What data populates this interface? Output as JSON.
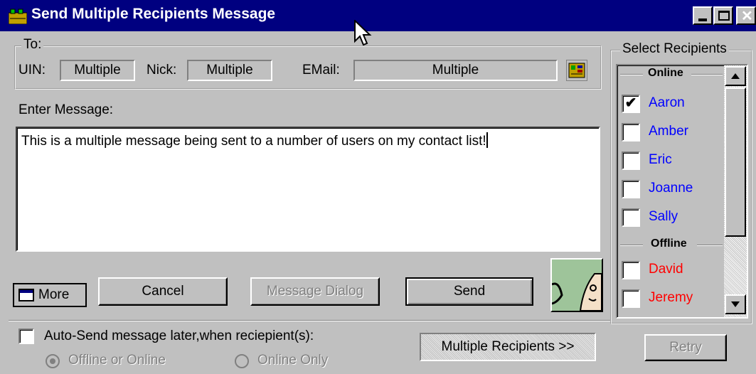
{
  "window": {
    "title": "Send Multiple Recipients Message"
  },
  "to": {
    "legend": "To:",
    "uin_label": "UIN:",
    "uin_value": "Multiple",
    "nick_label": "Nick:",
    "nick_value": "Multiple",
    "email_label": "EMail:",
    "email_value": "Multiple"
  },
  "message": {
    "label": "Enter Message:",
    "text": "This is a multiple message being sent to a number of users on my contact list!"
  },
  "buttons": {
    "more": "More",
    "cancel": "Cancel",
    "message_dialog": "Message Dialog",
    "send": "Send",
    "multiple_recipients": "Multiple Recipients >>",
    "retry": "Retry"
  },
  "auto_send": {
    "label": "Auto-Send message later,when reciepient(s):",
    "checked": false,
    "option_offline_online": "Offline or Online",
    "option_online_only": "Online Only",
    "selected": "Offline or Online"
  },
  "recipients": {
    "legend": "Select Recipients",
    "online_header": "Online",
    "offline_header": "Offline",
    "online": [
      {
        "name": "Aaron",
        "checked": true
      },
      {
        "name": "Amber",
        "checked": false
      },
      {
        "name": "Eric",
        "checked": false
      },
      {
        "name": "Joanne",
        "checked": false
      },
      {
        "name": "Sally",
        "checked": false
      }
    ],
    "offline": [
      {
        "name": "David",
        "checked": false
      },
      {
        "name": "Jeremy",
        "checked": false
      }
    ]
  },
  "colors": {
    "titlebar": "#000080",
    "online_name": "#0000ff",
    "offline_name": "#ff0000",
    "face": "#c0c0c0"
  }
}
